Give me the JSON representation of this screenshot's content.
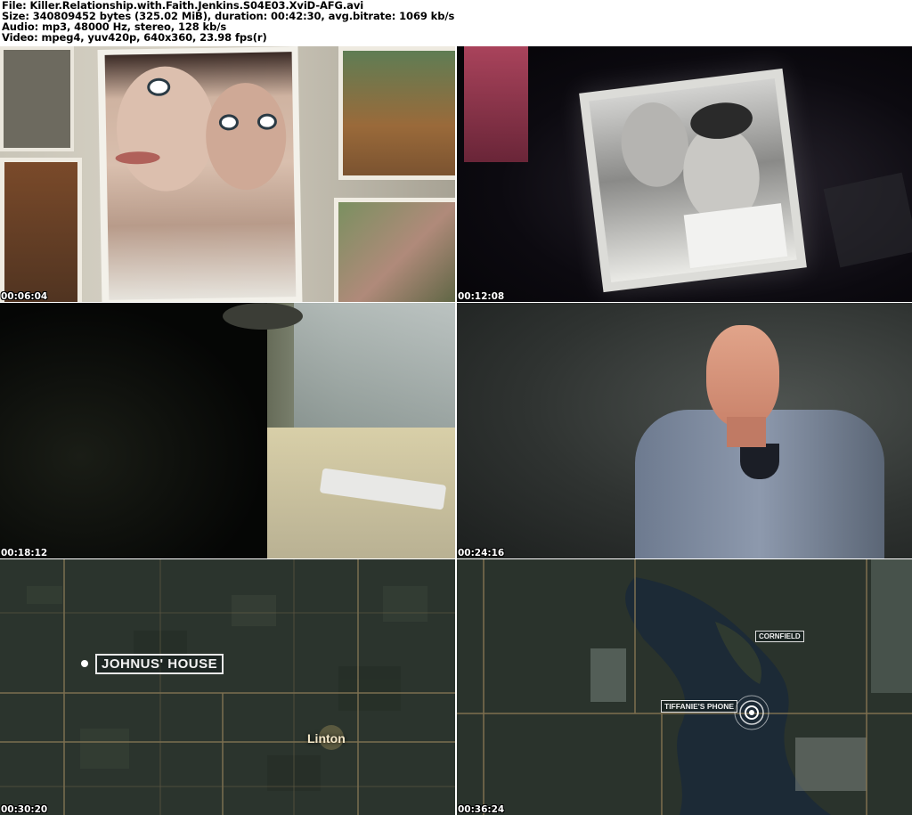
{
  "header": {
    "file_line": "File: Killer.Relationship.with.Faith.Jenkins.S04E03.XviD-AFG.avi",
    "size_line": "Size: 340809452 bytes (325.02 MiB), duration: 00:42:30, avg.bitrate: 1069 kb/s",
    "audio_line": "Audio: mp3, 48000 Hz, stereo, 128 kb/s",
    "video_line": "Video: mpeg4, yuv420p, 640x360, 23.98 fps(r)"
  },
  "frames": [
    {
      "timestamp": "00:06:04",
      "scene": "selfie-photos-on-wall"
    },
    {
      "timestamp": "00:12:08",
      "scene": "couple-photo-in-dark"
    },
    {
      "timestamp": "00:18:12",
      "scene": "person-writing-at-desk"
    },
    {
      "timestamp": "00:24:16",
      "scene": "interview-older-man"
    },
    {
      "timestamp": "00:30:20",
      "scene": "satellite-map-linton",
      "labels": {
        "house": "JOHNUS' HOUSE",
        "town": "Linton"
      }
    },
    {
      "timestamp": "00:36:24",
      "scene": "satellite-map-lake",
      "labels": {
        "field": "CORNFIELD",
        "phone": "TIFFANIE'S PHONE"
      }
    }
  ]
}
